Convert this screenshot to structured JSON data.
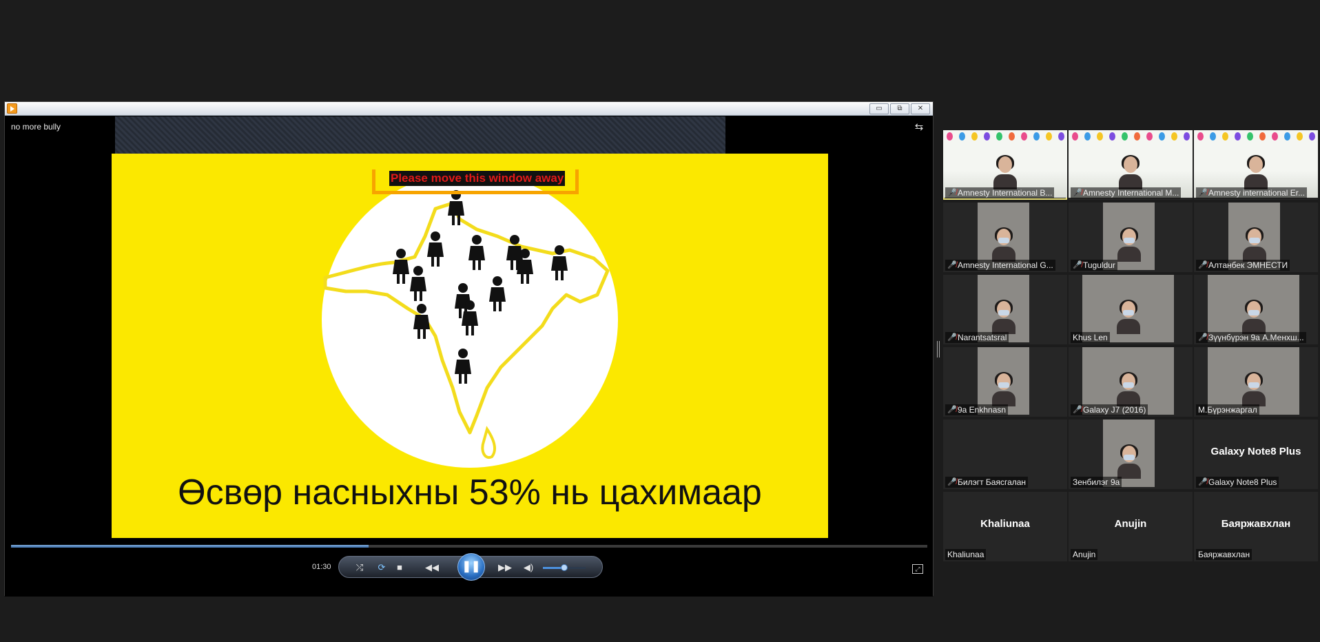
{
  "player": {
    "window_controls": {
      "minimize": "▭",
      "restore": "⧉",
      "close": "✕"
    },
    "video_title": "no more bully",
    "slide": {
      "warning": "Please move this window away",
      "caption": "Өсвөр насныхны 53% нь цахимаар"
    },
    "controls": {
      "time": "01:30",
      "progress_fraction": 0.39,
      "volume_fraction": 0.5
    }
  },
  "participants": [
    {
      "name": "Amnesty International B...",
      "muted": true,
      "video": "banner",
      "active": true
    },
    {
      "name": "Amnesty International M...",
      "muted": true,
      "video": "banner",
      "active": false
    },
    {
      "name": "Amnesty international Er...",
      "muted": true,
      "video": "banner",
      "active": false
    },
    {
      "name": "Amnesty International G...",
      "muted": true,
      "video": "narrow",
      "active": false
    },
    {
      "name": "Tuguldur",
      "muted": true,
      "video": "narrow",
      "active": false
    },
    {
      "name": "Алтанбек ЭМНЕСТИ",
      "muted": true,
      "video": "narrow",
      "active": false
    },
    {
      "name": "Narantsatsral",
      "muted": true,
      "video": "narrow",
      "active": false
    },
    {
      "name": "Khus Len",
      "muted": false,
      "video": "wide",
      "active": false
    },
    {
      "name": "Зүүнбүрэн 9а А.Менхш...",
      "muted": true,
      "video": "wide",
      "active": false
    },
    {
      "name": "9a Enkhnasn",
      "muted": true,
      "video": "narrow",
      "active": false
    },
    {
      "name": "Galaxy J7 (2016)",
      "muted": true,
      "video": "wide",
      "active": false
    },
    {
      "name": "М.Бүрэнжаргал",
      "muted": false,
      "video": "wide",
      "active": false
    },
    {
      "name": "Билэгт Баясгалан",
      "muted": true,
      "video": "none",
      "active": false
    },
    {
      "name": "Зенбилэг 9а",
      "muted": false,
      "video": "narrow",
      "active": false
    },
    {
      "name": "Galaxy Note8 Plus",
      "muted": true,
      "video": "none",
      "display": "Galaxy Note8 Plus",
      "active": false
    },
    {
      "name": "Khaliunaa",
      "muted": false,
      "video": "none",
      "display": "Khaliunaa",
      "active": false
    },
    {
      "name": "Anujin",
      "muted": false,
      "video": "none",
      "display": "Anujin",
      "active": false
    },
    {
      "name": "Баяржавхлан",
      "muted": false,
      "video": "none",
      "display": "Баяржавхлан",
      "active": false
    }
  ],
  "colors": {
    "slide_bg": "#fbe800",
    "accent": "#f7a400",
    "warning_text": "#e11919"
  },
  "icons": {
    "mic": "mic-off-icon",
    "layout": "layout-icon",
    "fullscreen": "fullscreen-icon"
  }
}
